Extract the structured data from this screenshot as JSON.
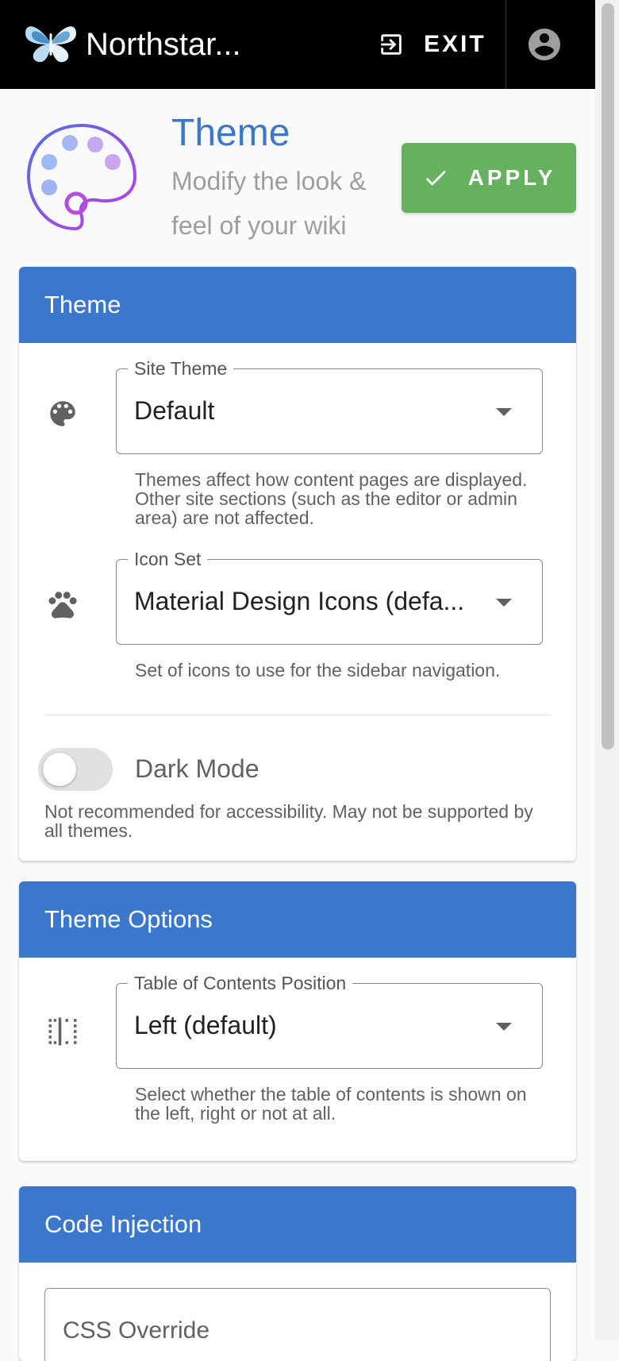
{
  "app": {
    "site_title": "Northstar..."
  },
  "topbar": {
    "exit_label": "EXIT",
    "exit_icon": "exit-to-app-icon",
    "account_icon": "account-circle-icon"
  },
  "header": {
    "title": "Theme",
    "subtitle": "Modify the look & feel of your wiki",
    "apply_label": "APPLY",
    "icon": "palette-icon"
  },
  "theme_card": {
    "title": "Theme",
    "site_theme": {
      "label": "Site Theme",
      "value": "Default",
      "hint": "Themes affect how content pages are displayed. Other site sections (such as the editor or admin area) are not affected."
    },
    "icon_set": {
      "label": "Icon Set",
      "value": "Material Design Icons (defa...",
      "hint": "Set of icons to use for the sidebar navigation."
    },
    "dark_mode": {
      "label": "Dark Mode",
      "enabled": false,
      "hint": "Not recommended for accessibility. May not be supported by all themes."
    }
  },
  "theme_options_card": {
    "title": "Theme Options",
    "toc_position": {
      "label": "Table of Contents Position",
      "value": "Left (default)",
      "hint": "Select whether the table of contents is shown on the left, right or not at all."
    }
  },
  "code_injection_card": {
    "title": "Code Injection",
    "css_override_label": "CSS Override"
  },
  "colors": {
    "accent": "#3b78cc",
    "apply": "#66b160",
    "topbar": "#000000"
  }
}
